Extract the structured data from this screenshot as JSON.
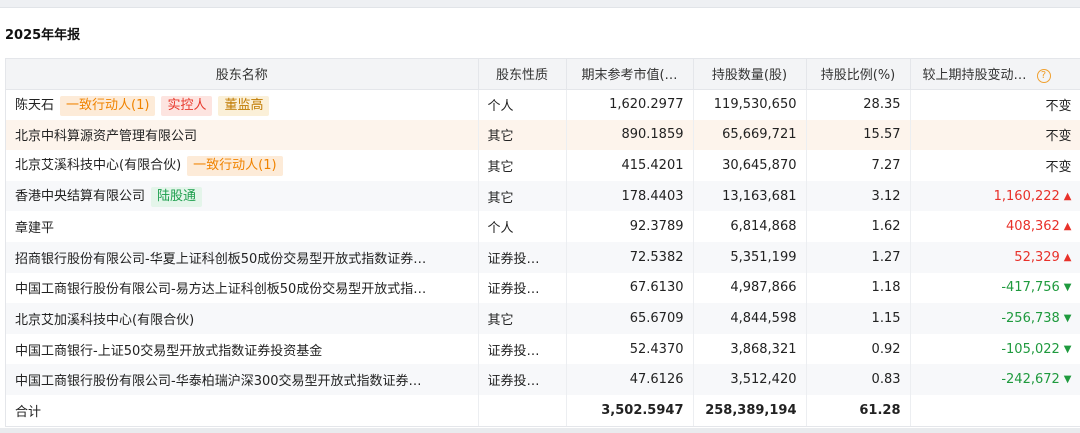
{
  "section_title": "2025年年报",
  "headers": {
    "name": "股东名称",
    "nature": "股东性质",
    "market_value": "期末参考市值(…",
    "shares": "持股数量(股)",
    "ratio": "持股比例(%)",
    "change": "较上期持股变动…"
  },
  "rows": [
    {
      "name": "陈天石",
      "tags": [
        {
          "text": "一致行动人(1)",
          "style": "orange"
        },
        {
          "text": "实控人",
          "style": "red"
        },
        {
          "text": "董监高",
          "style": "gold"
        }
      ],
      "nature": "个人",
      "market_value": "1,620.2977",
      "shares": "119,530,650",
      "ratio": "28.35",
      "change": "不变",
      "direction": "same"
    },
    {
      "name": "北京中科算源资产管理有限公司",
      "tags": [],
      "nature": "其它",
      "market_value": "890.1859",
      "shares": "65,669,721",
      "ratio": "15.57",
      "change": "不变",
      "direction": "same"
    },
    {
      "name": "北京艾溪科技中心(有限合伙)",
      "tags": [
        {
          "text": "一致行动人(1)",
          "style": "orange"
        }
      ],
      "nature": "其它",
      "market_value": "415.4201",
      "shares": "30,645,870",
      "ratio": "7.27",
      "change": "不变",
      "direction": "same"
    },
    {
      "name": "香港中央结算有限公司",
      "tags": [
        {
          "text": "陆股通",
          "style": "green"
        }
      ],
      "nature": "其它",
      "market_value": "178.4403",
      "shares": "13,163,681",
      "ratio": "3.12",
      "change": "1,160,222",
      "direction": "up"
    },
    {
      "name": "章建平",
      "tags": [],
      "nature": "个人",
      "market_value": "92.3789",
      "shares": "6,814,868",
      "ratio": "1.62",
      "change": "408,362",
      "direction": "up"
    },
    {
      "name": "招商银行股份有限公司-华夏上证科创板50成份交易型开放式指数证券…",
      "tags": [],
      "nature": "证券投…",
      "market_value": "72.5382",
      "shares": "5,351,199",
      "ratio": "1.27",
      "change": "52,329",
      "direction": "up"
    },
    {
      "name": "中国工商银行股份有限公司-易方达上证科创板50成份交易型开放式指…",
      "tags": [],
      "nature": "证券投…",
      "market_value": "67.6130",
      "shares": "4,987,866",
      "ratio": "1.18",
      "change": "-417,756",
      "direction": "down"
    },
    {
      "name": "北京艾加溪科技中心(有限合伙)",
      "tags": [],
      "nature": "其它",
      "market_value": "65.6709",
      "shares": "4,844,598",
      "ratio": "1.15",
      "change": "-256,738",
      "direction": "down"
    },
    {
      "name": "中国工商银行-上证50交易型开放式指数证券投资基金",
      "tags": [],
      "nature": "证券投…",
      "market_value": "52.4370",
      "shares": "3,868,321",
      "ratio": "0.92",
      "change": "-105,022",
      "direction": "down"
    },
    {
      "name": "中国工商银行股份有限公司-华泰柏瑞沪深300交易型开放式指数证券…",
      "tags": [],
      "nature": "证券投…",
      "market_value": "47.6126",
      "shares": "3,512,420",
      "ratio": "0.83",
      "change": "-242,672",
      "direction": "down"
    }
  ],
  "total": {
    "label": "合计",
    "market_value": "3,502.5947",
    "shares": "258,389,194",
    "ratio": "61.28"
  },
  "icons": {
    "help": "question-circle-icon",
    "up": "triangle-up-icon",
    "down": "triangle-down-icon"
  },
  "colors": {
    "up": "#e8312a",
    "down": "#1f9a3e",
    "accent": "#f08300"
  }
}
